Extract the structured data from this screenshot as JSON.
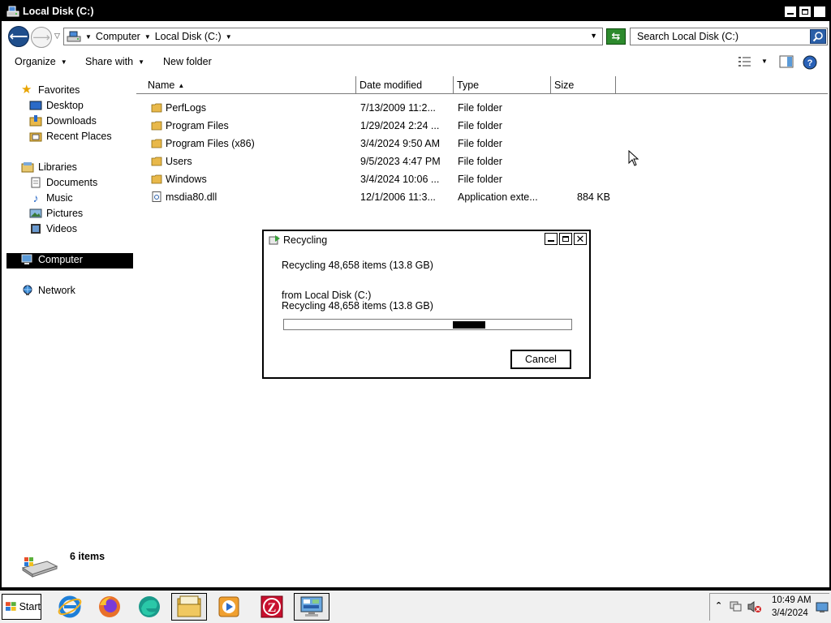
{
  "window": {
    "title": "Local Disk (C:)"
  },
  "address": {
    "crumbs": [
      "Computer",
      "Local Disk (C:)"
    ],
    "search_placeholder": "Search Local Disk (C:)"
  },
  "toolbar": {
    "organize": "Organize",
    "share_with": "Share with",
    "new_folder": "New folder"
  },
  "navpane": {
    "favorites": "Favorites",
    "desktop": "Desktop",
    "downloads": "Downloads",
    "recent_places": "Recent Places",
    "libraries": "Libraries",
    "documents": "Documents",
    "music": "Music",
    "pictures": "Pictures",
    "videos": "Videos",
    "computer": "Computer",
    "network": "Network"
  },
  "columns": {
    "name": "Name",
    "date_modified": "Date modified",
    "type": "Type",
    "size": "Size"
  },
  "files": [
    {
      "name": "PerfLogs",
      "date": "7/13/2009 11:2...",
      "type": "File folder",
      "size": "",
      "kind": "folder"
    },
    {
      "name": "Program Files",
      "date": "1/29/2024 2:24 ...",
      "type": "File folder",
      "size": "",
      "kind": "folder"
    },
    {
      "name": "Program Files (x86)",
      "date": "3/4/2024 9:50 AM",
      "type": "File folder",
      "size": "",
      "kind": "folder"
    },
    {
      "name": "Users",
      "date": "9/5/2023 4:47 PM",
      "type": "File folder",
      "size": "",
      "kind": "folder"
    },
    {
      "name": "Windows",
      "date": "3/4/2024 10:06 ...",
      "type": "File folder",
      "size": "",
      "kind": "folder"
    },
    {
      "name": "msdia80.dll",
      "date": "12/1/2006 11:3...",
      "type": "Application exte...",
      "size": "884 KB",
      "kind": "dll"
    }
  ],
  "status": {
    "items": "6 items"
  },
  "dialog": {
    "title": "Recycling",
    "line1": "Recycling 48,658 items (13.8 GB)",
    "line2": "from Local Disk (C:)",
    "line3": "Recycling 48,658 items (13.8 GB)",
    "cancel": "Cancel",
    "progress_state": "indeterminate"
  },
  "taskbar": {
    "start": "Start",
    "apps": [
      "internet-explorer-icon",
      "firefox-icon",
      "edge-icon",
      "file-explorer-icon",
      "media-player-icon",
      "zotero-icon",
      "control-panel-icon"
    ],
    "time": "10:49 AM",
    "date": "3/4/2024"
  },
  "colors": {
    "titlebar": "#000000",
    "selection": "#000000",
    "folder": "#e8b84a",
    "nav_back": "#1f4e8c",
    "refresh": "#2d8a2d"
  }
}
